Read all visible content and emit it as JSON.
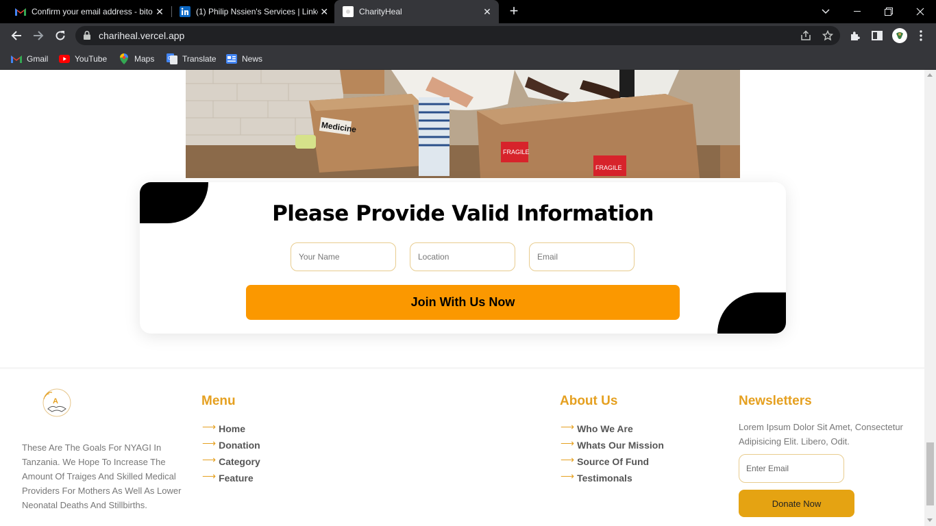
{
  "browser": {
    "tabs": [
      {
        "title": "Confirm your email address - bito",
        "favicon": "gmail-icon"
      },
      {
        "title": "(1) Philip Nssien's Services | Linke",
        "favicon": "linkedin-icon"
      },
      {
        "title": "CharityHeal",
        "favicon": "page-icon",
        "active": true
      }
    ],
    "url": "chariheal.vercel.app",
    "bookmarks": [
      {
        "label": "Gmail",
        "icon": "gmail-icon"
      },
      {
        "label": "YouTube",
        "icon": "youtube-icon"
      },
      {
        "label": "Maps",
        "icon": "maps-icon"
      },
      {
        "label": "Translate",
        "icon": "translate-icon"
      },
      {
        "label": "News",
        "icon": "news-icon"
      }
    ]
  },
  "form": {
    "title": "Please Provide Valid Information",
    "name_placeholder": "Your Name",
    "location_placeholder": "Location",
    "email_placeholder": "Email",
    "submit_label": "Join With Us Now"
  },
  "hero": {
    "box_label_1": "Medicine",
    "box_label_2": "FRAGILE",
    "box_label_3": "FRAGILE"
  },
  "footer": {
    "about_text": "These Are The Goals For NYAGI In Tanzania. We Hope To Increase The Amount Of Traiges And Skilled Medical Providers For Mothers As Well As Lower Neonatal Deaths And Stillbirths.",
    "menu": {
      "heading": "Menu",
      "items": [
        "Home",
        "Donation",
        "Category",
        "Feature"
      ]
    },
    "about": {
      "heading": "About Us",
      "items": [
        "Who We Are",
        "Whats Our Mission",
        "Source Of Fund",
        "Testimonals"
      ]
    },
    "newsletter": {
      "heading": "Newsletters",
      "text": "Lorem Ipsum Dolor Sit Amet, Consectetur Adipisicing Elit. Libero, Odit.",
      "email_placeholder": "Enter Email",
      "button_label": "Donate Now"
    }
  },
  "colors": {
    "accent": "#fb9800",
    "footer_accent": "#e5a020",
    "input_border": "#e8cc8e"
  }
}
